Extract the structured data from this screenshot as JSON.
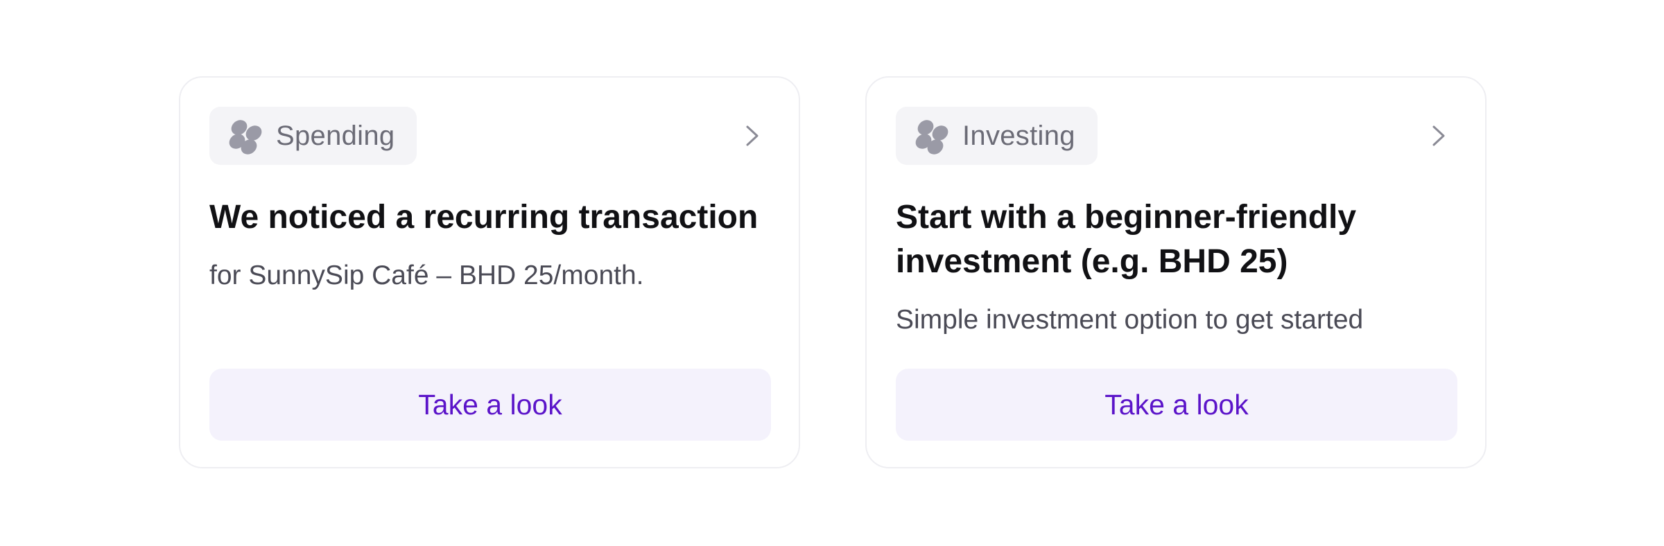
{
  "cards": [
    {
      "category": "Spending",
      "category_icon": "cluster-dots-icon",
      "title": "We noticed a recurring transaction",
      "subtitle": "for SunnySip Café – BHD 25/month.",
      "cta_label": "Take a look"
    },
    {
      "category": "Investing",
      "category_icon": "cluster-dots-icon",
      "title": "Start with a beginner-friendly investment (e.g. BHD 25)",
      "subtitle": "Simple investment option to get started",
      "cta_label": "Take a look"
    }
  ],
  "colors": {
    "accent": "#5b14c9",
    "cta_background": "#f4f2fc",
    "chip_background": "#f4f4f7",
    "icon_gray": "#9a9aa6",
    "card_border": "#eeeef2"
  }
}
